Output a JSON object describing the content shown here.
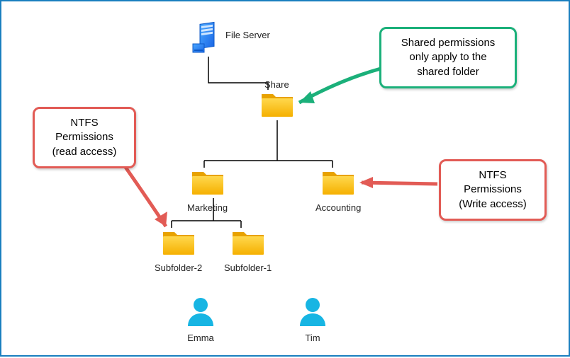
{
  "server": {
    "label": "File Server"
  },
  "folders": {
    "share": {
      "label": "Share"
    },
    "marketing": {
      "label": "Marketing"
    },
    "accounting": {
      "label": "Accounting"
    },
    "subfolder_2": {
      "label": "Subfolder-2"
    },
    "subfolder_1": {
      "label": "Subfolder-1"
    }
  },
  "users": {
    "emma": {
      "label": "Emma"
    },
    "tim": {
      "label": "Tim"
    }
  },
  "callouts": {
    "shared": {
      "text_l1": "Shared permissions",
      "text_l2": "only apply to the",
      "text_l3": "shared folder",
      "color": "#1bb07a"
    },
    "ntfs_read": {
      "text_l1": "NTFS",
      "text_l2": "Permissions",
      "text_l3": "(read access)",
      "color": "#e25b55"
    },
    "ntfs_write": {
      "text_l1": "NTFS",
      "text_l2": "Permissions",
      "text_l3": "(Write access)",
      "color": "#e25b55"
    }
  }
}
